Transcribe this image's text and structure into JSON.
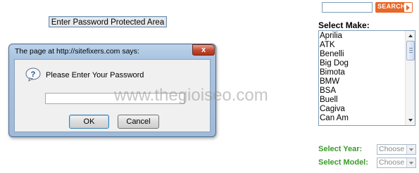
{
  "page": {
    "protected_area_button": "Enter Password Protected Area"
  },
  "dialog": {
    "title": "The page at http://sitefixers.com says:",
    "close_glyph": "x",
    "prompt": "Please Enter Your Password",
    "password_value": "",
    "ok_label": "OK",
    "cancel_label": "Cancel",
    "icon": "question-icon"
  },
  "watermark": "www.thegioiseo.com",
  "search": {
    "input_value": "",
    "button_label": "SEARCH",
    "button_color": "#e8672a",
    "arrow_icon": "arrow-right-icon"
  },
  "makes": {
    "heading": "Select Make:",
    "items": [
      "Aprilia",
      "ATK",
      "Benelli",
      "Big Dog",
      "Bimota",
      "BMW",
      "BSA",
      "Buell",
      "Cagiva",
      "Can Am"
    ]
  },
  "filters": {
    "label_color": "#3a9a2a",
    "year_label": "Select Year:",
    "year_value": "Choose",
    "model_label": "Select Model:",
    "model_value": "Choose"
  }
}
